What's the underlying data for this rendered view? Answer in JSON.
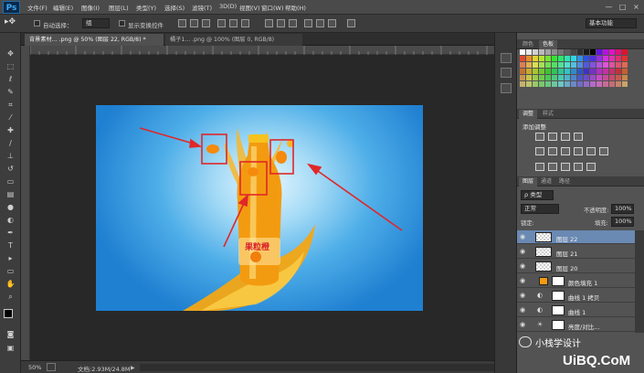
{
  "app": {
    "logo": "Ps"
  },
  "menu": [
    "文件(F)",
    "编辑(E)",
    "图像(I)",
    "图层(L)",
    "类型(Y)",
    "选择(S)",
    "滤镜(T)",
    "3D(D)",
    "视图(V)",
    "窗口(W)",
    "帮助(H)"
  ],
  "window_controls": [
    "—",
    "□",
    "×"
  ],
  "options": {
    "auto_select_label": "自动选择：",
    "auto_select_value": "组",
    "show_transform_label": "显示变换控件",
    "workspace": "基本功能"
  },
  "tabs": [
    {
      "label": "背景素材... .png @ 50% (图层 22, RGB/8) *"
    },
    {
      "label": "橘子1... .png @ 100% (图层 0, RGB/8)"
    }
  ],
  "status": {
    "zoom": "50%",
    "doc": "文档:2.93M/24.8M"
  },
  "panels": {
    "color_tabs": [
      "颜色",
      "色板"
    ],
    "adjust_tabs": [
      "调整",
      "样式"
    ],
    "adjust_title": "添加调整",
    "layer_tabs": [
      "图层",
      "通道",
      "路径"
    ],
    "filter_kind": "ρ 类型",
    "blend_mode": "正常",
    "opacity_label": "不透明度:",
    "opacity_value": "100%",
    "lock_label": "锁定:",
    "fill_label": "填充:",
    "fill_value": "100%"
  },
  "layers": [
    {
      "name": "图层 22"
    },
    {
      "name": "图层 21"
    },
    {
      "name": "图层 20"
    },
    {
      "name": "颜色填充 1"
    },
    {
      "name": "曲线 1 拷贝"
    },
    {
      "name": "曲线 1"
    },
    {
      "name": "亮度/对比..."
    }
  ],
  "bottle_brand": "果粒橙",
  "watermark": "小栈学设计",
  "site_watermark": "UiBQ.CoM",
  "colors": {
    "accent_red": "#e0272a",
    "orange": "#f59a11",
    "selected_layer": "#6a89b3"
  }
}
